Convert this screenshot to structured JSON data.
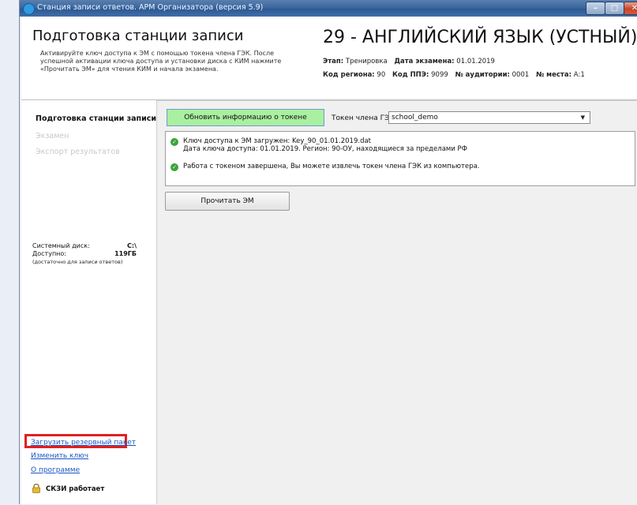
{
  "window": {
    "title": "Станция записи ответов. АРМ Организатора (версия 5.9)"
  },
  "header": {
    "title": "Подготовка станции записи",
    "description": "Активируйте ключ доступа к ЭМ с помощью токена члена ГЭК. После успешной активации ключа доступа и установки диска с КИМ нажмите «Прочитать ЭМ» для чтения КИМ и начала экзамена.",
    "exam_title": "29 - АНГЛИЙСКИЙ ЯЗЫК (УСТНЫЙ)",
    "stage_label": "Этап:",
    "stage_value": "Тренировка",
    "date_label": "Дата экзамена:",
    "date_value": "01.01.2019",
    "region_label": "Код региона:",
    "region_value": "90",
    "ppe_label": "Код ППЭ:",
    "ppe_value": "9099",
    "room_label": "№ аудитории:",
    "room_value": "0001",
    "seat_label": "№ места:",
    "seat_value": "А:1"
  },
  "sidebar": {
    "nav": [
      "Подготовка станции записи",
      "Экзамен",
      "Экспорт результатов"
    ],
    "disk_label": "Системный диск:",
    "disk_value": "C:\\",
    "free_label": "Доступно:",
    "free_value": "119ГБ",
    "free_note": "(достаточно для записи ответов)",
    "links": [
      "Загрузить резервный пакет",
      "Изменить ключ",
      "О программе"
    ],
    "skzi_status": "СКЗИ работает"
  },
  "main": {
    "update_button": "Обновить информацию о токене",
    "token_label": "Токен члена ГЭК",
    "token_value": "school_demo",
    "log": [
      {
        "line1": "Ключ доступа к ЭМ загружен: Key_90_01.01.2019.dat",
        "line2": "Дата ключа доступа: 01.01.2019. Регион: 90-ОУ, находящиеся за пределами РФ"
      },
      {
        "line1": "Работа с токеном завершена, Вы можете извлечь токен члена ГЭК из компьютера.",
        "line2": ""
      }
    ],
    "read_button": "Прочитать ЭМ"
  }
}
